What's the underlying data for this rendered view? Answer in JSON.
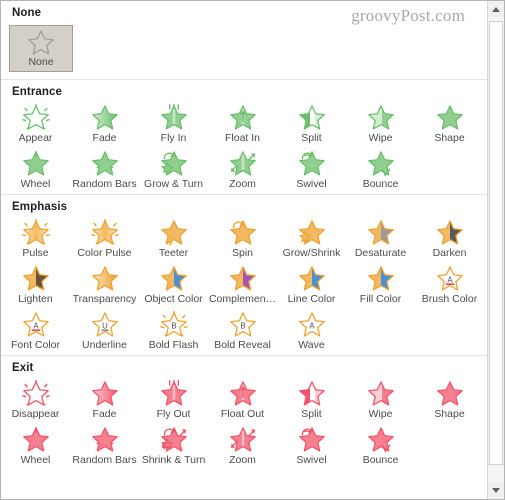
{
  "watermark": "groovyPost.com",
  "colors": {
    "entrance": "#6cbf6c",
    "emphasis": "#efa22e",
    "exit": "#f2556b",
    "none": "#9e9e9e",
    "panel_border": "#b4b4b4",
    "label_text": "#4c4c4c",
    "title_text": "#1f1f1f",
    "selected_bg": "#d4d0c8"
  },
  "scrollbar": {
    "up_icon": "chevron-up-icon",
    "down_icon": "chevron-down-icon",
    "thumb_name": "scrollbar-thumb"
  },
  "sections": [
    {
      "id": "none",
      "title": "None",
      "color": "#9e9e9e",
      "selected": true,
      "rows": [
        [
          {
            "label": "None",
            "icon": "star-outline-icon"
          }
        ]
      ]
    },
    {
      "id": "entrance",
      "title": "Entrance",
      "color": "#6cbf6c",
      "rows": [
        [
          {
            "label": "Appear",
            "icon": "star-burst-icon"
          },
          {
            "label": "Fade",
            "icon": "star-fade-icon"
          },
          {
            "label": "Fly In",
            "icon": "star-fly-in-icon"
          },
          {
            "label": "Float In",
            "icon": "star-float-in-icon"
          },
          {
            "label": "Split",
            "icon": "star-split-icon"
          },
          {
            "label": "Wipe",
            "icon": "star-wipe-icon"
          },
          {
            "label": "Shape",
            "icon": "star-shape-icon"
          }
        ],
        [
          {
            "label": "Wheel",
            "icon": "star-wheel-icon"
          },
          {
            "label": "Random Bars",
            "icon": "star-random-bars-icon"
          },
          {
            "label": "Grow & Turn",
            "icon": "star-grow-turn-icon"
          },
          {
            "label": "Zoom",
            "icon": "star-zoom-icon"
          },
          {
            "label": "Swivel",
            "icon": "star-swivel-icon"
          },
          {
            "label": "Bounce",
            "icon": "star-bounce-icon"
          }
        ]
      ]
    },
    {
      "id": "emphasis",
      "title": "Emphasis",
      "color": "#efa22e",
      "rows": [
        [
          {
            "label": "Pulse",
            "icon": "star-pulse-icon"
          },
          {
            "label": "Color Pulse",
            "icon": "star-color-pulse-icon"
          },
          {
            "label": "Teeter",
            "icon": "star-teeter-icon"
          },
          {
            "label": "Spin",
            "icon": "star-spin-icon"
          },
          {
            "label": "Grow/Shrink",
            "icon": "star-grow-shrink-icon"
          },
          {
            "label": "Desaturate",
            "icon": "star-desaturate-icon"
          },
          {
            "label": "Darken",
            "icon": "star-darken-icon"
          }
        ],
        [
          {
            "label": "Lighten",
            "icon": "star-lighten-icon"
          },
          {
            "label": "Transparency",
            "icon": "star-transparency-icon"
          },
          {
            "label": "Object Color",
            "icon": "star-object-color-icon"
          },
          {
            "label": "Complemen…",
            "icon": "star-complementary-color-icon"
          },
          {
            "label": "Line Color",
            "icon": "star-line-color-icon"
          },
          {
            "label": "Fill Color",
            "icon": "star-fill-color-icon"
          },
          {
            "label": "Brush Color",
            "icon": "star-brush-color-icon"
          }
        ],
        [
          {
            "label": "Font Color",
            "icon": "star-font-color-icon"
          },
          {
            "label": "Underline",
            "icon": "star-underline-icon"
          },
          {
            "label": "Bold Flash",
            "icon": "star-bold-flash-icon"
          },
          {
            "label": "Bold Reveal",
            "icon": "star-bold-reveal-icon"
          },
          {
            "label": "Wave",
            "icon": "star-wave-icon"
          }
        ]
      ]
    },
    {
      "id": "exit",
      "title": "Exit",
      "color": "#f2556b",
      "rows": [
        [
          {
            "label": "Disappear",
            "icon": "star-burst-icon"
          },
          {
            "label": "Fade",
            "icon": "star-fade-icon"
          },
          {
            "label": "Fly Out",
            "icon": "star-fly-out-icon"
          },
          {
            "label": "Float Out",
            "icon": "star-float-out-icon"
          },
          {
            "label": "Split",
            "icon": "star-split-icon"
          },
          {
            "label": "Wipe",
            "icon": "star-wipe-icon"
          },
          {
            "label": "Shape",
            "icon": "star-shape-icon"
          }
        ],
        [
          {
            "label": "Wheel",
            "icon": "star-wheel-icon"
          },
          {
            "label": "Random Bars",
            "icon": "star-random-bars-icon"
          },
          {
            "label": "Shrink & Turn",
            "icon": "star-shrink-turn-icon"
          },
          {
            "label": "Zoom",
            "icon": "star-zoom-icon"
          },
          {
            "label": "Swivel",
            "icon": "star-swivel-icon"
          },
          {
            "label": "Bounce",
            "icon": "star-bounce-icon"
          }
        ]
      ]
    }
  ]
}
